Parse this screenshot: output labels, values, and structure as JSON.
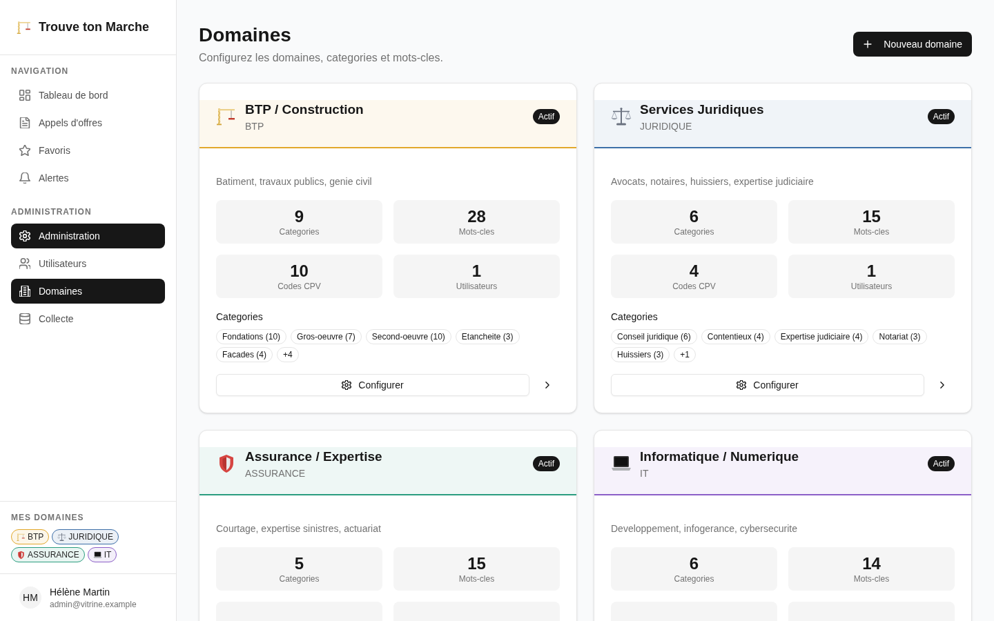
{
  "sidebar": {
    "app_name": "Trouve ton Marche",
    "sections": [
      {
        "title": "NAVIGATION",
        "items": [
          {
            "label": "Tableau de bord",
            "selected": false
          },
          {
            "label": "Appels d'offres",
            "selected": false
          },
          {
            "label": "Favoris",
            "selected": false
          },
          {
            "label": "Alertes",
            "selected": false
          }
        ]
      },
      {
        "title": "ADMINISTRATION",
        "items": [
          {
            "label": "Administration",
            "selected": true
          },
          {
            "label": "Utilisateurs",
            "selected": false
          },
          {
            "label": "Domaines",
            "selected": true
          },
          {
            "label": "Collecte",
            "selected": false
          }
        ]
      }
    ],
    "my_domains": {
      "title": "MES DOMAINES",
      "badges": [
        {
          "label": "BTP",
          "color": "#e2a82b"
        },
        {
          "label": "JURIDIQUE",
          "color": "#3d6fa8"
        },
        {
          "label": "ASSURANCE",
          "color": "#2a9d7f"
        },
        {
          "label": "IT",
          "color": "#8b5fc7"
        }
      ]
    },
    "user": {
      "initials": "HM",
      "name": "Hélène Martin",
      "email": "admin@vitrine.example"
    }
  },
  "header": {
    "title": "Domaines",
    "subtitle": "Configurez les domaines, categories et mots-cles.",
    "new_button": "Nouveau domaine"
  },
  "domains": [
    {
      "name": "BTP / Construction",
      "code": "BTP",
      "color": "#e2a82b",
      "status": "Actif",
      "description": "Batiment, travaux publics, genie civil",
      "stats": [
        {
          "value": "9",
          "label": "Categories"
        },
        {
          "value": "28",
          "label": "Mots-cles"
        },
        {
          "value": "10",
          "label": "Codes CPV"
        },
        {
          "value": "1",
          "label": "Utilisateurs"
        }
      ],
      "categories_title": "Categories",
      "categories": [
        "Fondations (10)",
        "Gros-oeuvre (7)",
        "Second-oeuvre (10)",
        "Etancheite (3)",
        "Facades (4)",
        "+4"
      ],
      "configure_button": "Configurer"
    },
    {
      "name": "Services Juridiques",
      "code": "JURIDIQUE",
      "color": "#3d6fa8",
      "status": "Actif",
      "description": "Avocats, notaires, huissiers, expertise judiciaire",
      "stats": [
        {
          "value": "6",
          "label": "Categories"
        },
        {
          "value": "15",
          "label": "Mots-cles"
        },
        {
          "value": "4",
          "label": "Codes CPV"
        },
        {
          "value": "1",
          "label": "Utilisateurs"
        }
      ],
      "categories_title": "Categories",
      "categories": [
        "Conseil juridique (6)",
        "Contentieux (4)",
        "Expertise judiciaire (4)",
        "Notariat (3)",
        "Huissiers (3)",
        "+1"
      ],
      "configure_button": "Configurer"
    },
    {
      "name": "Assurance / Expertise",
      "code": "ASSURANCE",
      "color": "#2a9d7f",
      "status": "Actif",
      "description": "Courtage, expertise sinistres, actuariat",
      "stats": [
        {
          "value": "5",
          "label": "Categories"
        },
        {
          "value": "15",
          "label": "Mots-cles"
        }
      ]
    },
    {
      "name": "Informatique / Numerique",
      "code": "IT",
      "color": "#8b5fc7",
      "status": "Actif",
      "description": "Developpement, infogerance, cybersecurite",
      "stats": [
        {
          "value": "6",
          "label": "Categories"
        },
        {
          "value": "14",
          "label": "Mots-cles"
        }
      ]
    }
  ]
}
